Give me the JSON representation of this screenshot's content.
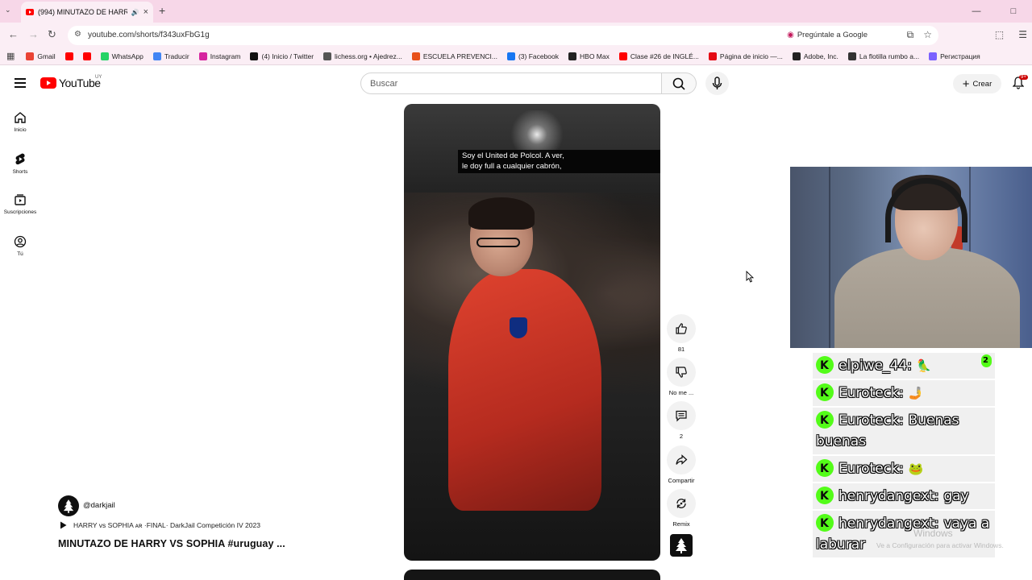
{
  "browser": {
    "tab": {
      "title": "(994) MINUTAZO DE HARR",
      "sound_icon": "speaker-icon"
    },
    "url": "youtube.com/shorts/f343uxFbG1g",
    "ask_google": "Pregúntale a Google",
    "bookmarks": [
      {
        "label": "Gmail",
        "color": "#ea4335"
      },
      {
        "label": "",
        "color": "#ff0000"
      },
      {
        "label": "",
        "color": "#ff0000"
      },
      {
        "label": "WhatsApp",
        "color": "#25d366"
      },
      {
        "label": "Traducir",
        "color": "#4285f4"
      },
      {
        "label": "Instagram",
        "color": "#d6249f"
      },
      {
        "label": "(4) Inicio / Twitter",
        "color": "#111111"
      },
      {
        "label": "lichess.org • Ajedrez...",
        "color": "#555555"
      },
      {
        "label": "ESCUELA PREVENCI...",
        "color": "#e8501b"
      },
      {
        "label": "(3) Facebook",
        "color": "#1877f2"
      },
      {
        "label": "HBO Max",
        "color": "#222222"
      },
      {
        "label": "Clase #26 de INGLÉ...",
        "color": "#ff0000"
      },
      {
        "label": "Página de inicio —...",
        "color": "#e50914"
      },
      {
        "label": "Adobe, Inc.",
        "color": "#222222"
      },
      {
        "label": "La flotilla rumbo a...",
        "color": "#333333"
      },
      {
        "label": "Регистрация",
        "color": "#7b61ff"
      }
    ]
  },
  "youtube": {
    "logo_text": "YouTube",
    "country_code": "UY",
    "search_placeholder": "Buscar",
    "create_label": "Crear",
    "notifications_badge": "9+",
    "guide": [
      {
        "label": "Inicio",
        "icon": "home-icon"
      },
      {
        "label": "Shorts",
        "icon": "shorts-icon"
      },
      {
        "label": "Suscripciones",
        "icon": "subscriptions-icon"
      },
      {
        "label": "Tú",
        "icon": "you-icon"
      }
    ]
  },
  "short": {
    "caption": "Soy el United de Polcol. A ver,\nle doy full a cualquier cabrón,",
    "channel_handle": "@darkjail",
    "playlist": "HARRY vs SOPHIA ᴀʀ ·FINAL· DarkJail Competición IV 2023",
    "title": "MINUTAZO DE HARRY VS SOPHIA  #uruguay ...",
    "actions": {
      "like_count": "81",
      "dislike_label": "No me ...",
      "comments_count": "2",
      "share_label": "Compartir",
      "remix_label": "Remix"
    }
  },
  "chat": [
    {
      "user": "elpiwe_44:",
      "message": "",
      "emote": "🦜",
      "badge": "2"
    },
    {
      "user": "Euroteck:",
      "message": "",
      "emote": "🤳"
    },
    {
      "user": "Euroteck:",
      "message": "Buenas buenas",
      "emote": ""
    },
    {
      "user": "Euroteck:",
      "message": "",
      "emote": "🐸"
    },
    {
      "user": "henrydangext:",
      "message": "gay",
      "emote": ""
    },
    {
      "user": "henrydangext:",
      "message": "vaya a laburar",
      "emote": ""
    }
  ],
  "watermark": {
    "line1": "Windows",
    "line2": "Ve a Configuración para activar Windows."
  }
}
